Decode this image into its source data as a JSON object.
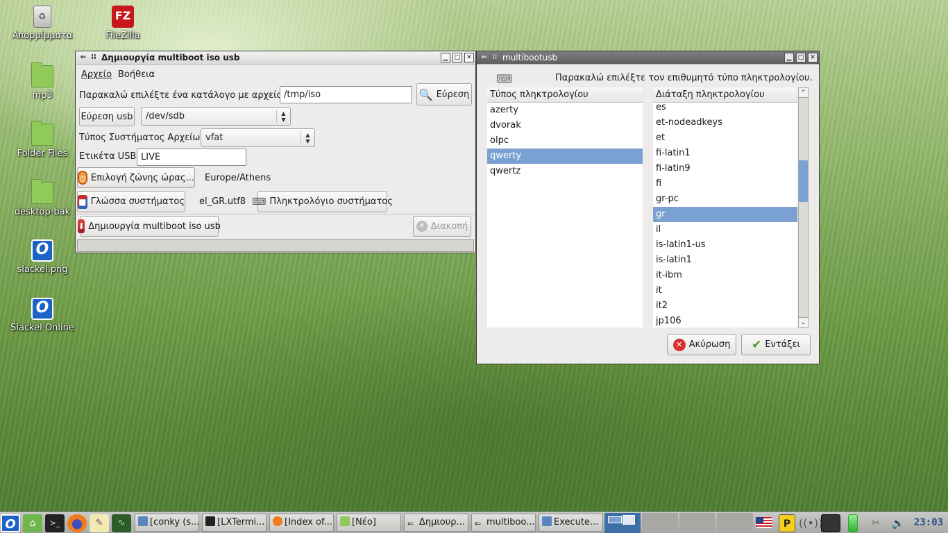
{
  "desktop": {
    "icons": [
      {
        "label": "Απορρίμματα",
        "icon": "trash-icon"
      },
      {
        "label": "FileZilla",
        "icon": "filezilla-icon"
      },
      {
        "label": "mp3",
        "icon": "folder-icon"
      },
      {
        "label": "Folder Files",
        "icon": "folder-icon"
      },
      {
        "label": "desktop-bak",
        "icon": "folder-icon"
      },
      {
        "label": "slackel.png",
        "icon": "slackel-icon"
      },
      {
        "label": "Slackel Online",
        "icon": "slackel-icon"
      }
    ],
    "filezilla_glyph": "FZ",
    "slackel_glyph": "O"
  },
  "main_window": {
    "title": "Δημιουργία multiboot iso usb",
    "menu": {
      "file": "Αρχείο",
      "help": "Βοήθεια"
    },
    "iso_label": "Παρακαλώ επιλέξτε ένα κατάλογο με αρχεία iso.",
    "iso_path": "/tmp/iso",
    "search_button": "Εύρεση",
    "find_usb_button": "Εύρεση usb",
    "usb_device": "/dev/sdb",
    "fs_label": "Τύπος Συστήματος Αρχείων:",
    "fs_value": "vfat",
    "usb_label_label": "Ετικέτα USB:",
    "usb_label_value": "LIVE",
    "timezone_button": "Επιλογή ζώνης ώρας...",
    "timezone_value": "Europe/Athens",
    "language_button": "Γλώσσα συστήματος",
    "language_value": "el_GR.utf8",
    "keyboard_button": "Πληκτρολόγιο συστήματος",
    "create_button": "Δημιουργία multiboot iso usb",
    "cancel_button": "Διακοπή"
  },
  "keyboard_dialog": {
    "title": "multibootusb",
    "prompt": "Παρακαλώ επιλέξτε τον επιθυμητό τύπο πληκτρολογίου.",
    "type_header": "Τύπος πληκτρολογίου",
    "types": [
      "azerty",
      "dvorak",
      "olpc",
      "qwerty",
      "qwertz"
    ],
    "selected_type": "qwerty",
    "layout_header": "Διάταξη πληκτρολογίου",
    "layouts": [
      "es",
      "et-nodeadkeys",
      "et",
      "fi-latin1",
      "fi-latin9",
      "fi",
      "gr-pc",
      "gr",
      "il",
      "is-latin1-us",
      "is-latin1",
      "it-ibm",
      "it",
      "it2",
      "jp106"
    ],
    "selected_layout": "gr",
    "scroll_position": 0.35,
    "cancel_button": "Ακύρωση",
    "ok_button": "Εντάξει"
  },
  "taskbar": {
    "tasks": [
      {
        "label": "[conky (s...",
        "icon": "window-icon"
      },
      {
        "label": "[LXTermi...",
        "icon": "terminal-icon"
      },
      {
        "label": "[Index of...",
        "icon": "firefox-icon"
      },
      {
        "label": "[Νέο]",
        "icon": "folder-icon"
      },
      {
        "label": "Δημιουρ...",
        "icon": "window-icon"
      },
      {
        "label": "multiboo...",
        "icon": "window-icon"
      },
      {
        "label": "Execute...",
        "icon": "window-icon"
      }
    ],
    "clock": "23:03",
    "keyboard_indicator": "P",
    "colors": {
      "accent": "#7aa1d2",
      "pager_active": "#3c6fa8"
    }
  }
}
